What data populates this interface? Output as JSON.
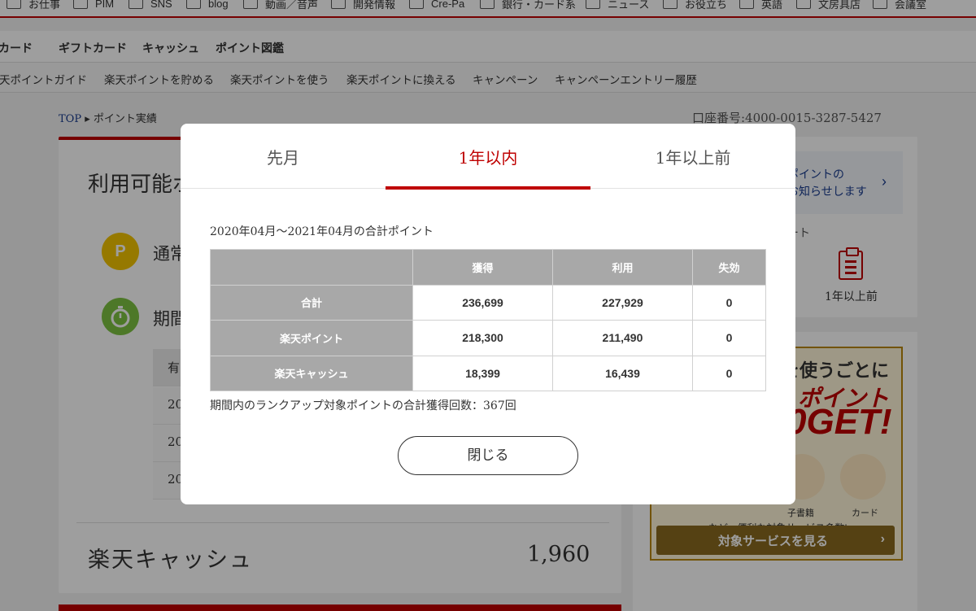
{
  "bookmarks": [
    "お仕事",
    "PIM",
    "SNS",
    "blog",
    "動画／音声",
    "開発情報",
    "Cre-Pa",
    "銀行・カード系",
    "ニュース",
    "お役立ち",
    "英語",
    "文房具店",
    "会議室"
  ],
  "nav_primary": [
    "カード",
    "ギフトカード",
    "キャッシュ",
    "ポイント図鑑"
  ],
  "nav_secondary": [
    "天ポイントガイド",
    "楽天ポイントを貯める",
    "楽天ポイントを使う",
    "楽天ポイントに換える",
    "キャンペーン",
    "キャンペーンエントリー履歴"
  ],
  "breadcrumb": {
    "top": "TOP",
    "separator": "▸",
    "current": "ポイント実績"
  },
  "account_number": "口座番号:4000-0015-3287-5427",
  "left_card": {
    "available_title": "利用可能ポ",
    "p_icon_letter": "P",
    "row_normal": "通常",
    "row_limited": "期間",
    "table_rows": [
      "有",
      "20",
      "20",
      "20"
    ],
    "cash_label": "楽天キャッシュ",
    "cash_value": "1,960"
  },
  "right_card": {
    "notice_line1": "ポイントの",
    "notice_line2": "お知らせします",
    "notice_chevron": "›",
    "report_label": "ート",
    "over_year_label": "1年以上前"
  },
  "banner": {
    "line1": "を使うごとに",
    "line2": "ポイント",
    "line3": "0GET!",
    "service1": "子書籍",
    "service2": "カード",
    "note": "など、便利な対象サービス多数!",
    "button": "対象サービスを見る",
    "button_chevron": "›"
  },
  "modal": {
    "tabs": [
      "先月",
      "1年以内",
      "1年以上前"
    ],
    "active_tab": 1,
    "period_text": "2020年04月〜2021年04月の合計ポイント",
    "table": {
      "columns": [
        "",
        "獲得",
        "利用",
        "失効"
      ],
      "rows": [
        {
          "label": "合計",
          "earned": "236,699",
          "used": "227,929",
          "expired": "0"
        },
        {
          "label": "楽天ポイント",
          "earned": "218,300",
          "used": "211,490",
          "expired": "0"
        },
        {
          "label": "楽天キャッシュ",
          "earned": "18,399",
          "used": "16,439",
          "expired": "0"
        }
      ]
    },
    "rank_text": "期間内のランクアップ対象ポイントの合計獲得回数：367回",
    "close_label": "閉じる"
  },
  "colors": {
    "accent": "#bf0000",
    "table_header": "#a8a8a8",
    "link": "#1a3d8f"
  }
}
